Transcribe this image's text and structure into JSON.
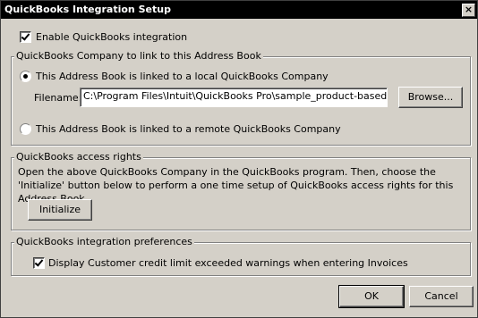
{
  "window": {
    "title": "QuickBooks Integration Setup",
    "close_glyph": "×"
  },
  "enable": {
    "label": "Enable QuickBooks integration",
    "checked": true
  },
  "company_group": {
    "legend": "QuickBooks Company to link to this Address Book",
    "local_radio_label": "This Address Book is linked to a local QuickBooks Company",
    "filename_label": "Filename:",
    "filename_value": "C:\\Program Files\\Intuit\\QuickBooks Pro\\sample_product-based business.ı",
    "browse_label": "Browse...",
    "remote_radio_label": "This Address Book is linked to a remote QuickBooks Company",
    "selected": "local"
  },
  "access_group": {
    "legend": "QuickBooks access rights",
    "text": "Open the above QuickBooks Company in the QuickBooks program. Then, choose the 'Initialize' button below to perform a one time setup of QuickBooks access rights for this Address Book.",
    "initialize_label": "Initialize"
  },
  "prefs_group": {
    "legend": "QuickBooks integration preferences",
    "credit_warning_label": "Display Customer credit limit exceeded warnings when entering Invoices",
    "checked": true
  },
  "buttons": {
    "ok": "OK",
    "cancel": "Cancel"
  }
}
